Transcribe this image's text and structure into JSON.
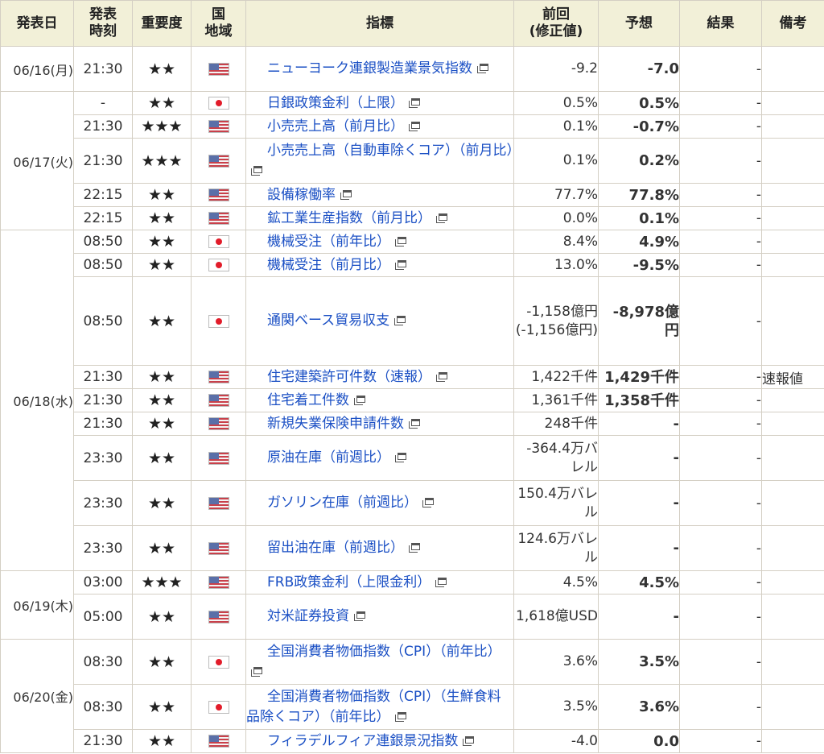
{
  "headers": {
    "date": "発表日",
    "time_l1": "発表",
    "time_l2": "時刻",
    "importance": "重要度",
    "country_l1": "国",
    "country_l2": "地域",
    "indicator": "指標",
    "prev_l1": "前回",
    "prev_l2": "(修正値)",
    "forecast": "予想",
    "result": "結果",
    "note": "備考"
  },
  "dates": {
    "d0616": "06/16(月)",
    "d0617": "06/17(火)",
    "d0618": "06/18(水)",
    "d0619": "06/19(木)",
    "d0620": "06/20(金)"
  },
  "flags": {
    "us": "us-flag-icon",
    "jp": "japan-flag-icon"
  },
  "rows": [
    {
      "time": "21:30",
      "stars": "★★",
      "country": "us",
      "indicator": "ニューヨーク連銀製造業景気指数",
      "prev": "-9.2",
      "forecast": "-7.0",
      "result": "-",
      "note": ""
    },
    {
      "time": "-",
      "stars": "★★",
      "country": "jp",
      "indicator": "日銀政策金利（上限）",
      "prev": "0.5%",
      "forecast": "0.5%",
      "result": "-",
      "note": ""
    },
    {
      "time": "21:30",
      "stars": "★★★",
      "country": "us",
      "indicator": "小売売上高（前月比）",
      "prev": "0.1%",
      "forecast": "-0.7%",
      "result": "-",
      "note": ""
    },
    {
      "time": "21:30",
      "stars": "★★★",
      "country": "us",
      "indicator": "小売売上高（自動車除くコア）（前月比）",
      "prev": "0.1%",
      "forecast": "0.2%",
      "result": "-",
      "note": ""
    },
    {
      "time": "22:15",
      "stars": "★★",
      "country": "us",
      "indicator": "設備稼働率",
      "prev": "77.7%",
      "forecast": "77.8%",
      "result": "-",
      "note": ""
    },
    {
      "time": "22:15",
      "stars": "★★",
      "country": "us",
      "indicator": "鉱工業生産指数（前月比）",
      "prev": "0.0%",
      "forecast": "0.1%",
      "result": "-",
      "note": ""
    },
    {
      "time": "08:50",
      "stars": "★★",
      "country": "jp",
      "indicator": "機械受注（前年比）",
      "prev": "8.4%",
      "forecast": "4.9%",
      "result": "-",
      "note": ""
    },
    {
      "time": "08:50",
      "stars": "★★",
      "country": "jp",
      "indicator": "機械受注（前月比）",
      "prev": "13.0%",
      "forecast": "-9.5%",
      "result": "-",
      "note": ""
    },
    {
      "time": "08:50",
      "stars": "★★",
      "country": "jp",
      "indicator": "通関ベース貿易収支",
      "prev": "-1,158億円(-1,156億円)",
      "forecast": "-8,978億円",
      "result": "-",
      "note": ""
    },
    {
      "time": "21:30",
      "stars": "★★",
      "country": "us",
      "indicator": "住宅建築許可件数（速報）",
      "prev": "1,422千件",
      "forecast": "1,429千件",
      "result": "-",
      "note": "速報値"
    },
    {
      "time": "21:30",
      "stars": "★★",
      "country": "us",
      "indicator": "住宅着工件数",
      "prev": "1,361千件",
      "forecast": "1,358千件",
      "result": "-",
      "note": ""
    },
    {
      "time": "21:30",
      "stars": "★★",
      "country": "us",
      "indicator": "新規失業保険申請件数",
      "prev": "248千件",
      "forecast": "-",
      "result": "-",
      "note": ""
    },
    {
      "time": "23:30",
      "stars": "★★",
      "country": "us",
      "indicator": "原油在庫（前週比）",
      "prev": "-364.4万バレル",
      "forecast": "-",
      "result": "-",
      "note": ""
    },
    {
      "time": "23:30",
      "stars": "★★",
      "country": "us",
      "indicator": "ガソリン在庫（前週比）",
      "prev": "150.4万バレル",
      "forecast": "-",
      "result": "-",
      "note": ""
    },
    {
      "time": "23:30",
      "stars": "★★",
      "country": "us",
      "indicator": "留出油在庫（前週比）",
      "prev": "124.6万バレル",
      "forecast": "-",
      "result": "-",
      "note": ""
    },
    {
      "time": "03:00",
      "stars": "★★★",
      "country": "us",
      "indicator": "FRB政策金利（上限金利）",
      "prev": "4.5%",
      "forecast": "4.5%",
      "result": "-",
      "note": ""
    },
    {
      "time": "05:00",
      "stars": "★★",
      "country": "us",
      "indicator": "対米証券投資",
      "prev": "1,618億USD",
      "forecast": "-",
      "result": "-",
      "note": ""
    },
    {
      "time": "08:30",
      "stars": "★★",
      "country": "jp",
      "indicator": "全国消費者物価指数（CPI）（前年比）",
      "prev": "3.6%",
      "forecast": "3.5%",
      "result": "-",
      "note": ""
    },
    {
      "time": "08:30",
      "stars": "★★",
      "country": "jp",
      "indicator": "全国消費者物価指数（CPI）（生鮮食料品除くコア）（前年比）",
      "prev": "3.5%",
      "forecast": "3.6%",
      "result": "-",
      "note": ""
    },
    {
      "time": "21:30",
      "stars": "★★",
      "country": "us",
      "indicator": "フィラデルフィア連銀景況指数",
      "prev": "-4.0",
      "forecast": "0.0",
      "result": "-",
      "note": ""
    }
  ]
}
